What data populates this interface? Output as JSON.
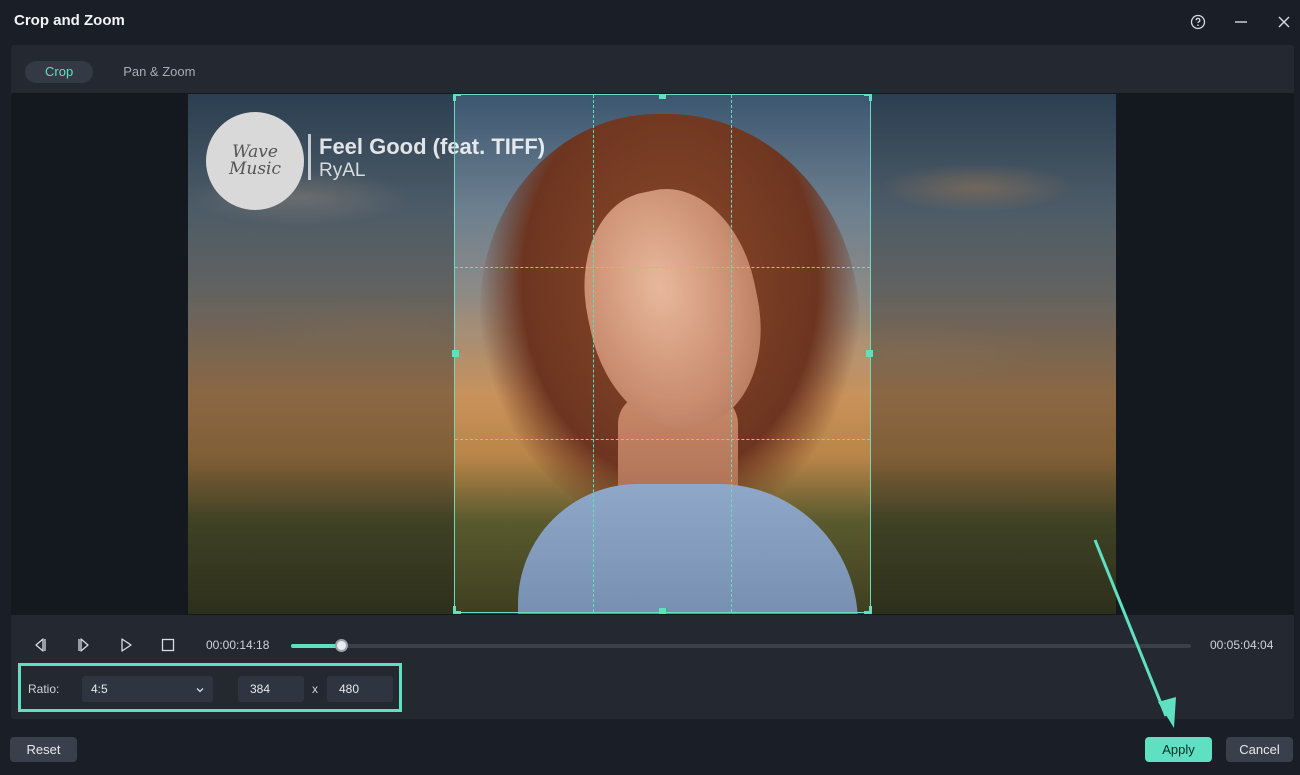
{
  "window": {
    "title": "Crop and Zoom",
    "controls": [
      "help-icon",
      "minimize-icon",
      "close-icon"
    ]
  },
  "tabs": [
    {
      "label": "Crop",
      "active": true
    },
    {
      "label": "Pan & Zoom",
      "active": false
    }
  ],
  "video_overlay": {
    "logo_text_line1": "Wave",
    "logo_text_line2": "Music",
    "song_title": "Feel Good (feat. TIFF)",
    "artist": "RyAL"
  },
  "playback": {
    "current_time": "00:00:14:18",
    "total_time": "00:05:04:04",
    "progress": 0.055,
    "icons": [
      "step-back-icon",
      "step-forward-icon",
      "play-icon",
      "stop-icon"
    ]
  },
  "crop": {
    "ratio_label": "Ratio:",
    "ratio_value": "4:5",
    "width": "384",
    "separator": "x",
    "height": "480"
  },
  "footer": {
    "reset_label": "Reset",
    "apply_label": "Apply",
    "cancel_label": "Cancel"
  },
  "colors": {
    "accent": "#5fe0c2",
    "background": "#1a1e26",
    "panel": "#232831"
  }
}
